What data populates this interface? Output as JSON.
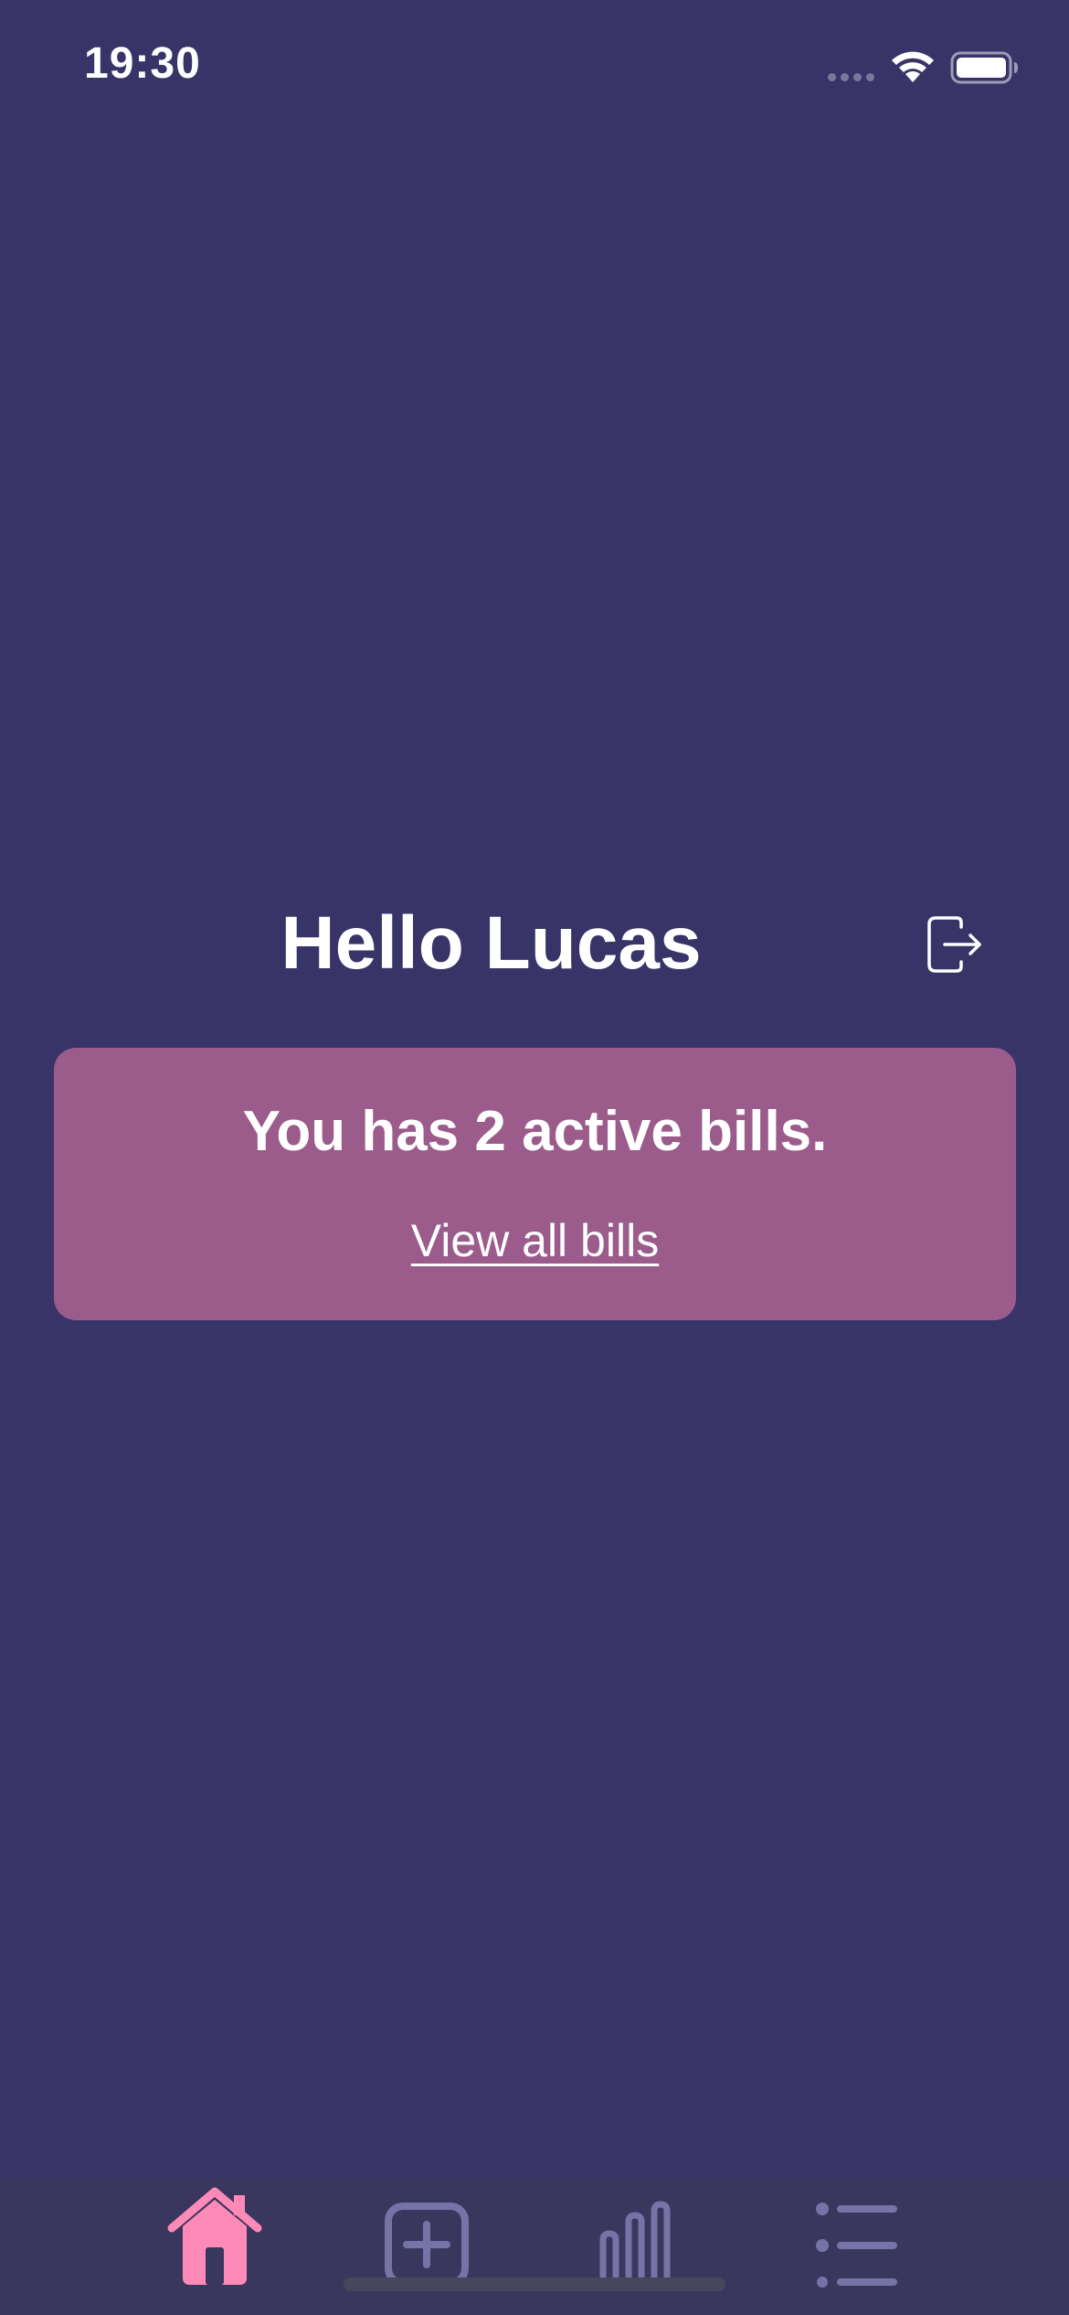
{
  "status_bar": {
    "time": "19:30"
  },
  "header": {
    "greeting": "Hello Lucas",
    "logout_icon": "logout-icon"
  },
  "bills_card": {
    "summary": "You has 2 active bills.",
    "link_label": "View all bills"
  },
  "tab_bar": {
    "items": [
      {
        "icon": "home-icon",
        "active": true
      },
      {
        "icon": "add-icon",
        "active": false
      },
      {
        "icon": "bar-chart-icon",
        "active": false
      },
      {
        "icon": "list-icon",
        "active": false
      }
    ]
  },
  "colors": {
    "background": "#383467",
    "card": "#9b5b8b",
    "tab_bar": "#3a375f",
    "tab_active": "#ff8ab8",
    "tab_inactive": "#7673a6",
    "text": "#ffffff"
  }
}
